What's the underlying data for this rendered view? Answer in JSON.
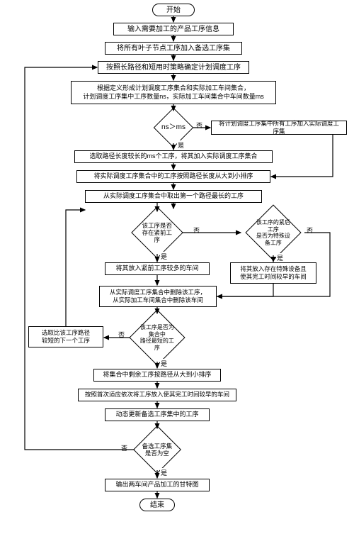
{
  "flowchart": {
    "start": "开始",
    "end": "结束",
    "n1": "输入需要加工的产品工序信息",
    "n2": "将所有叶子节点工序加入备选工序集",
    "n3": "按照长路径和短用时策略确定计划调度工序",
    "n4": "根据定义形成计划调度工序集合和实际加工车间集合，\n计划调度工序集中工序数量ns，实际加工车间集合中车间数量ms",
    "d1": "ns＞ms",
    "n5": "将计划调度工序集中所有工序加入实际调度工序集",
    "n6": "选取路径长度较长的ms个工序，将其加入实际调度工序集合",
    "n7": "将实际调度工序集合中的工序按照路径长度从大到小排序",
    "n8": "从实际调度工序集合中取出第一个路径最长的工序",
    "d2": "该工序是否存在紧前工序",
    "d3": "该工序的紧后工序\n是否为特殊设备工序",
    "n9": "将其放入紧前工序较多的车间",
    "n10": "将其放入存在特殊设备且\n使其完工时间较早的车间",
    "n11": "从实际调度工序集合中删除该工序，\n从实际加工车间集合中删除该车间",
    "d4": "该工序是否为集合中\n路径最短的工序",
    "n12s": "选取比该工序路径\n较短的下一个工序",
    "n12": "将集合中剩余工序按路径从大到小排序",
    "n13": "按照首次适应依次将工序放入使其完工时间较早的车间",
    "n14": "动态更新备选工序集中的工序",
    "d5": "备选工序集是否为空",
    "n15": "输出两车间产品加工的甘特图",
    "yes": "是",
    "no": "否"
  }
}
